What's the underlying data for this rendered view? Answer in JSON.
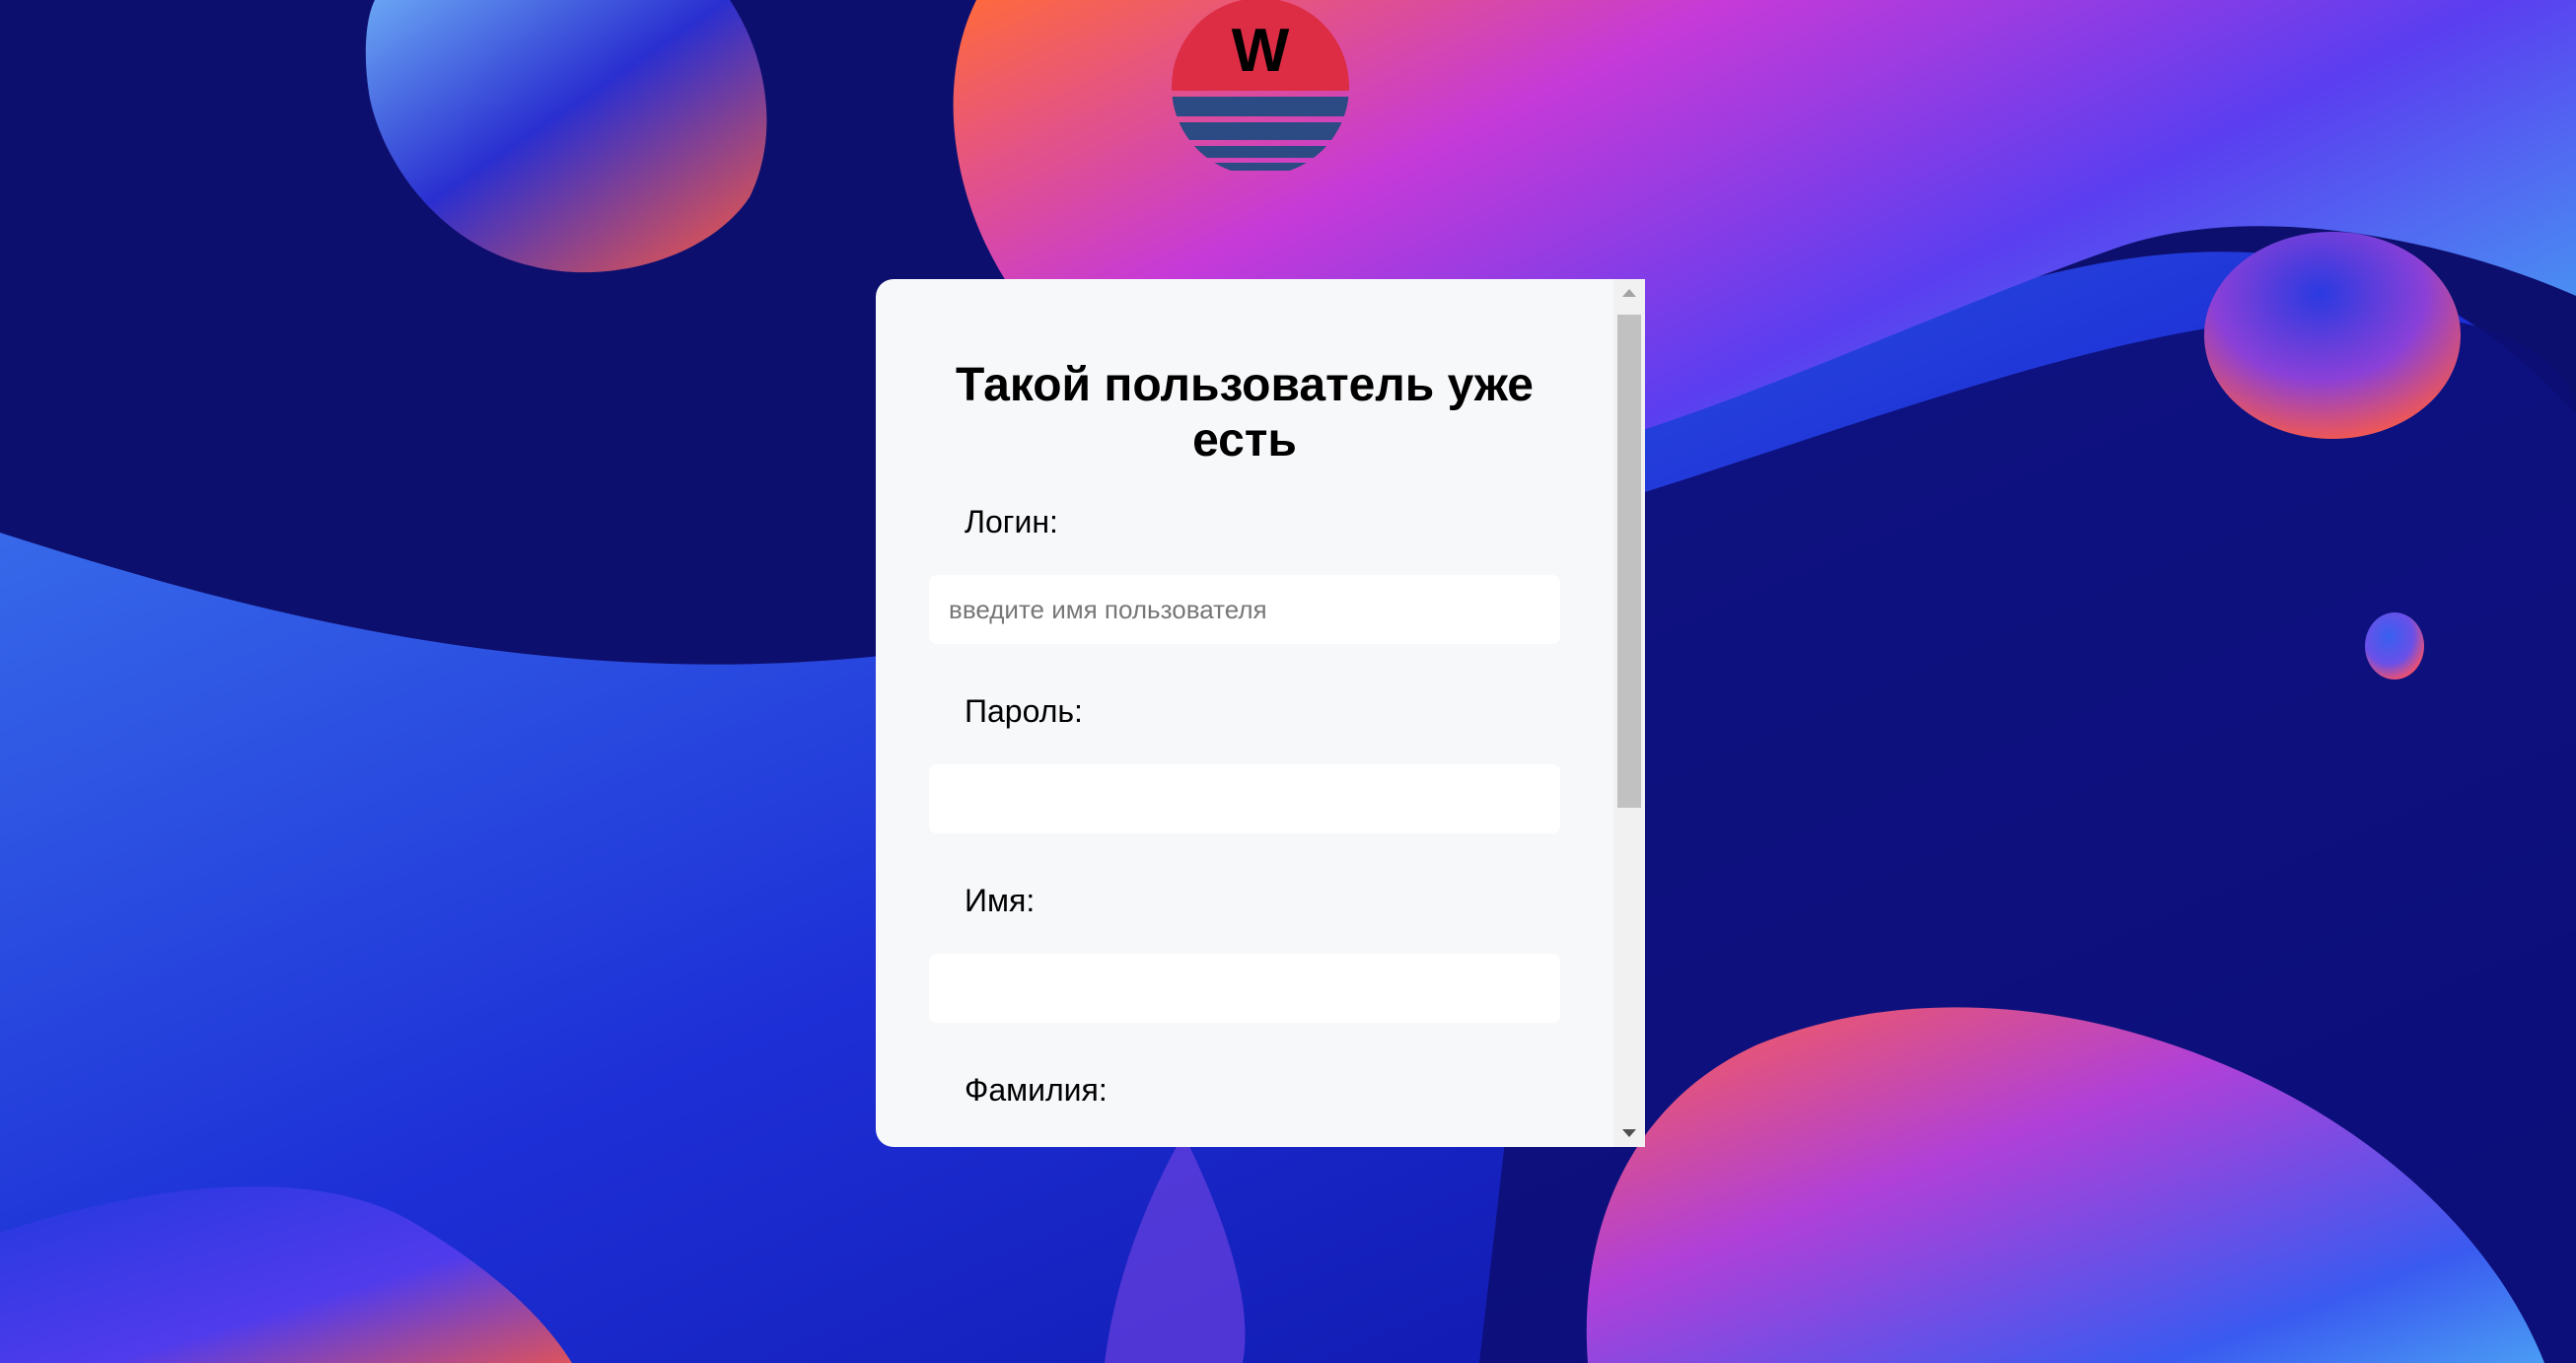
{
  "colors": {
    "background_dark": "#0d0f6e",
    "panel_bg": "#f7f8fa",
    "logo_red": "#dc2d45",
    "logo_stripe": "#2c4a84"
  },
  "logo": {
    "letter": "W",
    "icon": "sunset-logo-icon"
  },
  "form": {
    "title": "Такой пользователь уже есть",
    "fields": [
      {
        "label": "Логин:",
        "placeholder": "введите имя пользователя",
        "value": ""
      },
      {
        "label": "Пароль:",
        "placeholder": "",
        "value": ""
      },
      {
        "label": "Имя:",
        "placeholder": "",
        "value": ""
      },
      {
        "label": "Фамилия:",
        "placeholder": "",
        "value": ""
      }
    ]
  },
  "scrollbar": {
    "up_icon": "scroll-up-arrow-icon",
    "down_icon": "scroll-down-arrow-icon"
  }
}
